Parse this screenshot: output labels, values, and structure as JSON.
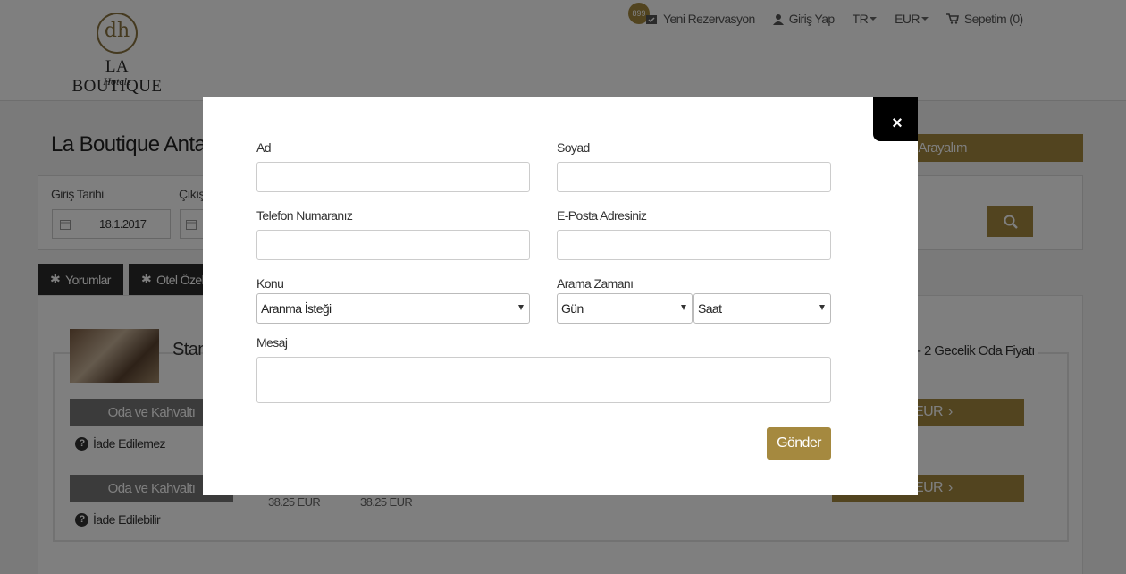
{
  "header": {
    "logo": {
      "monogram": "dh",
      "name": "LA BOUTIQUE",
      "sub": "Hotels"
    },
    "badge_count": "899",
    "nav": {
      "new_reservation": "Yeni Rezervasyon",
      "login": "Giriş Yap",
      "language": "TR",
      "currency": "EUR",
      "cart": "Sepetim (0)"
    }
  },
  "page": {
    "title": "La Boutique Antaly",
    "call_bar": "i Arayalım",
    "checkin_label": "Giriş Tarihi",
    "checkout_label": "Çıkış",
    "checkin_date": "18.1.2017",
    "tabs": [
      "Yorumlar",
      "Otel Özell"
    ],
    "room_name": "Stan",
    "price_heading": "- 2 Gecelik Oda Fiyatı",
    "boards": [
      "Oda ve Kahvaltı",
      "Oda ve Kahvaltı"
    ],
    "refunds": [
      "İade Edilemez",
      "İade Edilebilir"
    ],
    "price_buttons": [
      "EUR",
      "EUR"
    ],
    "prices": [
      "38.25 EUR",
      "38.25 EUR"
    ]
  },
  "modal": {
    "close": "×",
    "fields": {
      "first_name": {
        "label": "Ad",
        "value": ""
      },
      "last_name": {
        "label": "Soyad",
        "value": ""
      },
      "phone": {
        "label": "Telefon Numaranız",
        "value": ""
      },
      "email": {
        "label": "E-Posta Adresiniz",
        "value": ""
      },
      "subject": {
        "label": "Konu",
        "value": "Aranma İsteği"
      },
      "call_time": {
        "label": "Arama Zamanı",
        "day": "Gün",
        "hour": "Saat"
      },
      "message": {
        "label": "Mesaj",
        "value": ""
      }
    },
    "submit": "Gönder"
  },
  "colors": {
    "gold": "#a5893f",
    "dark": "#2a2a2a",
    "overlay": "rgba(0,0,0,0.5)"
  }
}
